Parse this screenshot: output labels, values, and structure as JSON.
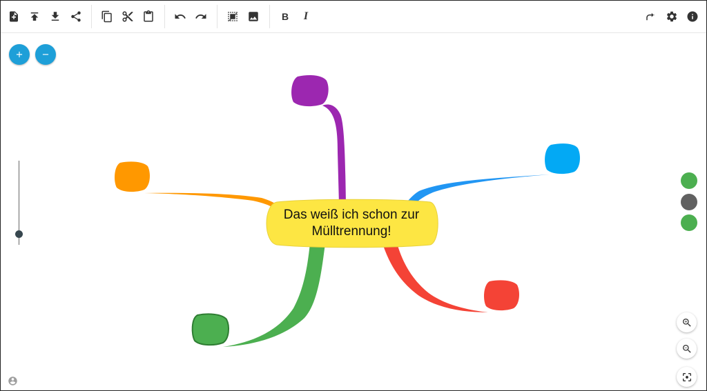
{
  "toolbar": {
    "bold_label": "B",
    "italic_label": "I",
    "icons": [
      "new-file-icon",
      "upload-icon",
      "download-icon",
      "share-icon",
      "copy-icon",
      "cut-icon",
      "paste-icon",
      "undo-icon",
      "redo-icon",
      "background-pattern-icon",
      "image-icon",
      "forward-icon",
      "gear-icon",
      "info-icon"
    ]
  },
  "mindmap": {
    "center_node": {
      "text": "Das weiß ich schon zur Mülltrennung!",
      "color": "#fde643"
    },
    "branches": [
      {
        "color": "#9c27b0",
        "label": ""
      },
      {
        "color": "#03a9f4",
        "label": ""
      },
      {
        "color": "#ff9800",
        "label": ""
      },
      {
        "color": "#f44336",
        "label": ""
      },
      {
        "color": "#4caf50",
        "label": ""
      }
    ]
  },
  "controls": {
    "add_node": "+",
    "remove_node": "−",
    "swatches": [
      "#4caf50",
      "#616161",
      "#4caf50"
    ]
  },
  "colors": {
    "accent": "#1e9fd8"
  }
}
